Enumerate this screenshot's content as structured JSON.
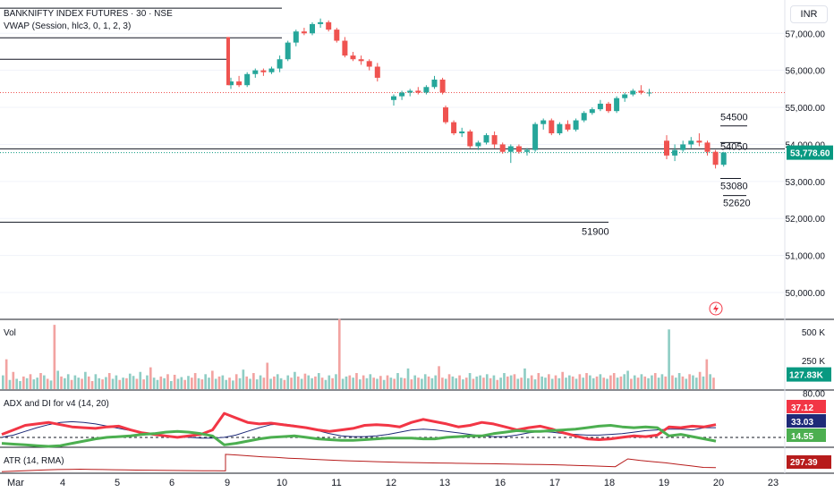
{
  "header": {
    "title": "BANKNIFTY INDEX FUTURES · 30 · NSE",
    "vwap_label": "VWAP (Session, hlc3, 0, 1, 2, 3)",
    "currency_button": "INR"
  },
  "colors": {
    "up": "#26a69a",
    "down": "#ef5350",
    "adx_line": "#1e2a78",
    "di_plus": "#4caf50",
    "di_minus": "#f23645",
    "atr": "#b71c1c",
    "vol_up": "#8fcdc4",
    "vol_down": "#f2a3a1",
    "level": "#131722",
    "last_price_bg": "#089981"
  },
  "chart_data": [
    {
      "type": "candlestick",
      "title": "BANKNIFTY INDEX FUTURES · 30 · NSE",
      "ylim": [
        49300,
        57900
      ],
      "y_ticks": [
        50000,
        51000,
        52000,
        53000,
        54000,
        55000,
        56000,
        57000
      ],
      "y_tick_labels": [
        "50,000.00",
        "51,000.00",
        "52,000.00",
        "53,000.00",
        "54,000.00",
        "55,000.00",
        "56,000.00",
        "57,000.00"
      ],
      "x_labels": [
        "Mar",
        "4",
        "5",
        "6",
        "9",
        "10",
        "11",
        "12",
        "13",
        "16",
        "17",
        "18",
        "19",
        "20",
        "23"
      ],
      "last_price": 53778.6,
      "last_price_label": "53,778.60",
      "annotations": [
        {
          "label": "54500",
          "value": 54500
        },
        {
          "label": "54050",
          "value": 54050
        },
        {
          "label": "53080",
          "value": 53080
        },
        {
          "label": "52620",
          "value": 52620
        },
        {
          "label": "51900",
          "value": 51900
        }
      ],
      "horizontal_levels": [
        57680,
        56880,
        56300,
        53880,
        51900
      ],
      "candles": [
        {
          "o": 55600,
          "h": 55800,
          "l": 55500,
          "c": 55700
        },
        {
          "o": 55700,
          "h": 55850,
          "l": 55550,
          "c": 55600
        },
        {
          "o": 55600,
          "h": 55950,
          "l": 55550,
          "c": 55900
        },
        {
          "o": 55900,
          "h": 56050,
          "l": 55800,
          "c": 56000
        },
        {
          "o": 56000,
          "h": 56050,
          "l": 55850,
          "c": 55950
        },
        {
          "o": 55950,
          "h": 56100,
          "l": 55900,
          "c": 56050
        },
        {
          "o": 56050,
          "h": 56400,
          "l": 55950,
          "c": 56300
        },
        {
          "o": 56300,
          "h": 56800,
          "l": 56250,
          "c": 56750
        },
        {
          "o": 56750,
          "h": 57100,
          "l": 56650,
          "c": 57050
        },
        {
          "o": 57050,
          "h": 57150,
          "l": 56950,
          "c": 57000
        },
        {
          "o": 57000,
          "h": 57300,
          "l": 56950,
          "c": 57250
        },
        {
          "o": 57250,
          "h": 57400,
          "l": 57150,
          "c": 57300
        },
        {
          "o": 57300,
          "h": 57350,
          "l": 57050,
          "c": 57100
        },
        {
          "o": 57100,
          "h": 57150,
          "l": 56750,
          "c": 56800
        },
        {
          "o": 56800,
          "h": 56900,
          "l": 56350,
          "c": 56400
        },
        {
          "o": 56400,
          "h": 56500,
          "l": 56250,
          "c": 56300
        },
        {
          "o": 56300,
          "h": 56400,
          "l": 56150,
          "c": 56250
        },
        {
          "o": 56250,
          "h": 56300,
          "l": 56000,
          "c": 56100
        },
        {
          "o": 56100,
          "h": 56200,
          "l": 55700,
          "c": 55800
        },
        {
          "o": 55200,
          "h": 55350,
          "l": 55050,
          "c": 55300
        },
        {
          "o": 55300,
          "h": 55450,
          "l": 55200,
          "c": 55400
        },
        {
          "o": 55400,
          "h": 55500,
          "l": 55300,
          "c": 55450
        },
        {
          "o": 55450,
          "h": 55550,
          "l": 55350,
          "c": 55400
        },
        {
          "o": 55400,
          "h": 55600,
          "l": 55350,
          "c": 55550
        },
        {
          "o": 55550,
          "h": 55850,
          "l": 55500,
          "c": 55750
        },
        {
          "o": 55750,
          "h": 55800,
          "l": 55350,
          "c": 55400
        },
        {
          "o": 55000,
          "h": 55050,
          "l": 54550,
          "c": 54600
        },
        {
          "o": 54600,
          "h": 54650,
          "l": 54250,
          "c": 54300
        },
        {
          "o": 54300,
          "h": 54450,
          "l": 54200,
          "c": 54350
        },
        {
          "o": 54350,
          "h": 54400,
          "l": 53900,
          "c": 53950
        },
        {
          "o": 53950,
          "h": 54100,
          "l": 53850,
          "c": 54050
        },
        {
          "o": 54050,
          "h": 54300,
          "l": 54000,
          "c": 54250
        },
        {
          "o": 54250,
          "h": 54350,
          "l": 53900,
          "c": 54000
        },
        {
          "o": 54000,
          "h": 54050,
          "l": 53750,
          "c": 53800
        },
        {
          "o": 53800,
          "h": 54000,
          "l": 53500,
          "c": 53950
        },
        {
          "o": 53950,
          "h": 54000,
          "l": 53750,
          "c": 53800
        },
        {
          "o": 53800,
          "h": 53900,
          "l": 53700,
          "c": 53850
        },
        {
          "o": 53850,
          "h": 54600,
          "l": 53800,
          "c": 54550
        },
        {
          "o": 54550,
          "h": 54700,
          "l": 54400,
          "c": 54650
        },
        {
          "o": 54650,
          "h": 54700,
          "l": 54250,
          "c": 54300
        },
        {
          "o": 54300,
          "h": 54600,
          "l": 54250,
          "c": 54550
        },
        {
          "o": 54550,
          "h": 54650,
          "l": 54350,
          "c": 54400
        },
        {
          "o": 54400,
          "h": 54700,
          "l": 54350,
          "c": 54650
        },
        {
          "o": 54650,
          "h": 54900,
          "l": 54600,
          "c": 54850
        },
        {
          "o": 54850,
          "h": 55000,
          "l": 54800,
          "c": 54950
        },
        {
          "o": 54950,
          "h": 55200,
          "l": 54900,
          "c": 55100
        },
        {
          "o": 55100,
          "h": 55150,
          "l": 54850,
          "c": 54900
        },
        {
          "o": 54900,
          "h": 55300,
          "l": 54850,
          "c": 55250
        },
        {
          "o": 55250,
          "h": 55400,
          "l": 55150,
          "c": 55350
        },
        {
          "o": 55350,
          "h": 55500,
          "l": 55300,
          "c": 55450
        },
        {
          "o": 55450,
          "h": 55600,
          "l": 55350,
          "c": 55400
        },
        {
          "o": 55400,
          "h": 55500,
          "l": 55300,
          "c": 55400
        },
        {
          "o": 54100,
          "h": 54250,
          "l": 53600,
          "c": 53700
        },
        {
          "o": 53700,
          "h": 54000,
          "l": 53550,
          "c": 53850
        },
        {
          "o": 53850,
          "h": 54100,
          "l": 53800,
          "c": 54000
        },
        {
          "o": 54000,
          "h": 54200,
          "l": 53900,
          "c": 54100
        },
        {
          "o": 54100,
          "h": 54300,
          "l": 53950,
          "c": 54050
        },
        {
          "o": 54050,
          "h": 54100,
          "l": 53700,
          "c": 53800
        },
        {
          "o": 53800,
          "h": 53850,
          "l": 53350,
          "c": 53450
        },
        {
          "o": 53450,
          "h": 53800,
          "l": 53400,
          "c": 53780
        }
      ]
    },
    {
      "type": "bar",
      "title": "Vol",
      "ylim": [
        0,
        600000
      ],
      "y_tick_labels": [
        "500 K",
        "250 K"
      ],
      "y_ticks": [
        500000,
        250000
      ],
      "last_value_label": "127.83K",
      "values": [
        120,
        260,
        80,
        150,
        90,
        70,
        110,
        95,
        130,
        85,
        100,
        140,
        120,
        90,
        75,
        560,
        160,
        110,
        95,
        130,
        80,
        120,
        100,
        90,
        150,
        110,
        70,
        130,
        95,
        85,
        105,
        140,
        90,
        120,
        80,
        100,
        95,
        135,
        115,
        90,
        150,
        85,
        120,
        190,
        100,
        80,
        110,
        95,
        130,
        70,
        125,
        90,
        105,
        80,
        115,
        100,
        140,
        95,
        85,
        130,
        100,
        160,
        90,
        110,
        120,
        80,
        100,
        75,
        130,
        95,
        170,
        110,
        90,
        140,
        85,
        120,
        100,
        230,
        90,
        110,
        130,
        95,
        80,
        120,
        100,
        150,
        110,
        90,
        135,
        120,
        95,
        110,
        140,
        100,
        80,
        120,
        95,
        130,
        610,
        90,
        110,
        120,
        100,
        140,
        85,
        120,
        95,
        130,
        100,
        90,
        115,
        80,
        120,
        100,
        90,
        140,
        100,
        95,
        180,
        85,
        120,
        100,
        90,
        130,
        110,
        95,
        120,
        200,
        100,
        90,
        130,
        110,
        95,
        120,
        85,
        100,
        140,
        90,
        110,
        120,
        100,
        130,
        95,
        120,
        80,
        100,
        140,
        110,
        120,
        130,
        90,
        100,
        180,
        95,
        120,
        85,
        140,
        110,
        100,
        130,
        90,
        120,
        95,
        150,
        100,
        120,
        110,
        90,
        130,
        100,
        140,
        120,
        95,
        110,
        130,
        100,
        90,
        120,
        140,
        100,
        110,
        130,
        160,
        90,
        120,
        100,
        130,
        110,
        95,
        120,
        140,
        100,
        130,
        110,
        520,
        120,
        100,
        140,
        110,
        90,
        130,
        120,
        100,
        150,
        110,
        260,
        130,
        100
      ],
      "up": [
        1,
        0,
        1,
        0,
        1,
        1,
        0,
        1,
        0,
        1,
        1,
        0,
        1,
        0,
        1,
        0,
        1,
        0,
        1,
        1,
        0,
        1,
        1,
        0,
        1,
        0,
        0,
        1,
        1,
        0,
        1,
        0,
        1,
        1,
        0,
        1,
        0,
        1,
        1,
        0,
        1,
        0,
        1,
        0,
        1,
        1,
        0,
        1,
        0,
        1,
        0,
        1,
        1,
        0,
        1,
        0,
        0,
        1,
        0,
        1,
        1,
        0,
        1,
        0,
        1,
        1,
        0,
        1,
        0,
        1,
        1,
        0,
        1,
        0,
        1,
        1,
        0,
        0,
        1,
        0,
        1,
        1,
        0,
        1,
        0,
        1,
        0,
        1,
        0,
        1,
        1,
        0,
        1,
        0,
        1,
        1,
        0,
        1,
        0,
        1,
        1,
        0,
        1,
        0,
        1,
        0,
        1,
        1,
        0,
        1,
        0,
        1,
        0,
        1,
        0,
        1,
        1,
        0,
        1,
        0,
        1,
        0,
        1,
        1,
        0,
        1,
        1,
        0,
        0,
        1,
        0,
        1,
        1,
        0,
        1,
        0,
        1,
        0,
        1,
        1,
        0,
        1,
        0,
        1,
        0,
        1,
        1,
        0,
        1,
        0,
        1,
        0,
        1,
        1,
        0,
        1,
        0,
        1,
        1,
        0,
        1,
        0,
        1,
        0,
        1,
        1,
        0,
        1,
        0,
        1,
        0,
        1,
        1,
        0,
        1,
        0,
        1,
        0,
        0,
        1,
        0,
        1,
        1,
        0,
        1,
        0,
        1,
        0,
        1,
        1,
        0,
        1
      ]
    },
    {
      "type": "line",
      "title": "ADX and DI for v4 (14, 20)",
      "ylim": [
        8,
        82
      ],
      "y_ticks": [
        80
      ],
      "y_tick_labels": [
        "80.00"
      ],
      "dashed_level": 20,
      "last_value_labels": [
        "37.12",
        "33.03",
        "14.55"
      ],
      "series": [
        {
          "values": [
            20,
            23,
            28,
            33,
            37,
            40,
            41,
            40,
            38,
            35,
            32,
            29,
            26,
            24,
            22,
            21,
            20,
            19,
            19,
            20,
            23,
            28,
            33,
            37,
            38,
            36,
            33,
            29,
            25,
            22,
            21,
            21,
            22,
            24,
            27,
            30,
            31,
            30,
            28,
            26,
            24,
            22,
            21,
            21,
            23,
            26,
            28,
            27,
            25,
            24,
            23,
            23,
            24,
            25,
            27,
            29,
            30,
            31,
            31,
            30,
            33,
            33
          ]
        },
        {
          "values": [
            24,
            30,
            36,
            38,
            40,
            37,
            34,
            33,
            32,
            34,
            35,
            30,
            26,
            24,
            22,
            20,
            22,
            24,
            30,
            52,
            46,
            40,
            38,
            39,
            37,
            35,
            33,
            30,
            28,
            30,
            32,
            36,
            37,
            36,
            34,
            40,
            44,
            41,
            38,
            34,
            36,
            40,
            38,
            34,
            30,
            33,
            35,
            31,
            26,
            22,
            18,
            17,
            18,
            20,
            22,
            21,
            23,
            34,
            33,
            35,
            34,
            37
          ]
        },
        {
          "values": [
            12,
            11,
            10,
            9,
            8,
            9,
            12,
            15,
            18,
            20,
            21,
            22,
            24,
            25,
            27,
            28,
            27,
            25,
            22,
            10,
            12,
            15,
            18,
            20,
            21,
            22,
            20,
            18,
            17,
            16,
            16,
            17,
            18,
            19,
            19,
            19,
            18,
            18,
            20,
            21,
            22,
            22,
            25,
            27,
            29,
            28,
            28,
            29,
            30,
            31,
            33,
            35,
            36,
            34,
            33,
            34,
            33,
            22,
            24,
            21,
            18,
            15
          ]
        }
      ]
    },
    {
      "type": "line",
      "title": "ATR (14, RMA)",
      "last_value_label": "297.39",
      "series": [
        {
          "values": [
            190,
            200,
            215,
            225,
            235,
            245,
            250,
            255,
            250,
            245,
            240,
            235,
            230,
            228,
            225,
            222,
            220,
            218,
            215,
            212,
            210,
            640,
            620,
            595,
            575,
            560,
            540,
            525,
            510,
            495,
            480,
            470,
            460,
            450,
            440,
            430,
            425,
            420,
            415,
            410,
            405,
            400,
            395,
            390,
            385,
            380,
            375,
            370,
            360,
            350,
            340,
            330,
            320,
            520,
            480,
            450,
            420,
            380,
            340,
            300,
            297
          ]
        }
      ]
    }
  ]
}
